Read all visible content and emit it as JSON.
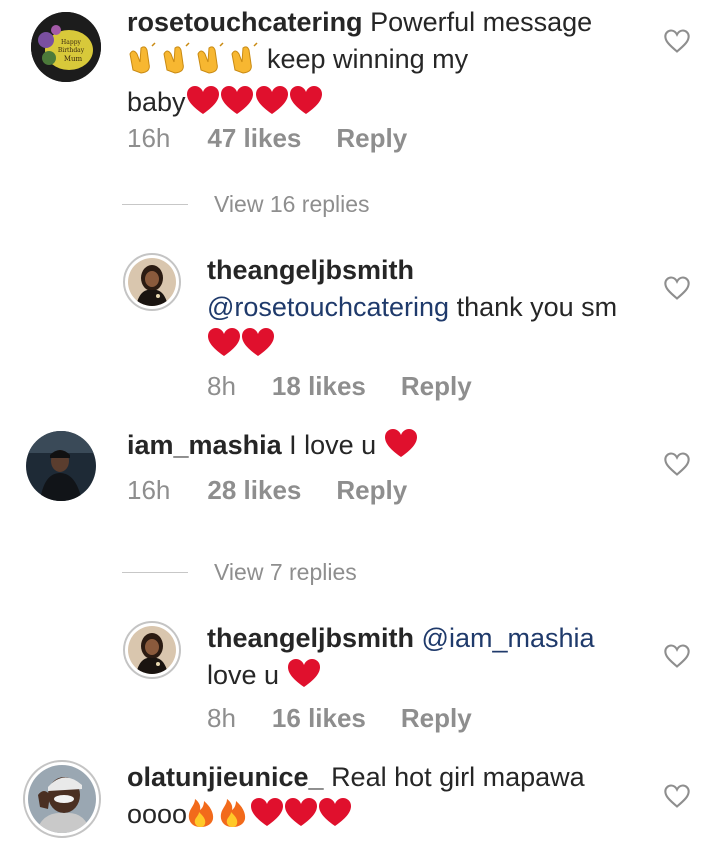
{
  "comments": [
    {
      "username": "rosetouchcatering",
      "text_line1": "Powerful message",
      "text_line2": "keep winning my",
      "text_line3": "baby",
      "time": "16h",
      "likes": "47 likes",
      "reply": "Reply",
      "avatar_text": "Happy Birthday Mum",
      "view_replies": "View 16 replies"
    },
    {
      "username": "theangeljbsmith",
      "mention": "@rosetouchcatering",
      "text": "thank you sm",
      "time": "8h",
      "likes": "18 likes",
      "reply": "Reply"
    },
    {
      "username": "iam_mashia",
      "text": "I love u",
      "time": "16h",
      "likes": "28 likes",
      "reply": "Reply",
      "view_replies": "View 7 replies"
    },
    {
      "username": "theangeljbsmith",
      "mention": "@iam_mashia",
      "text": "love u",
      "time": "8h",
      "likes": "16 likes",
      "reply": "Reply"
    },
    {
      "username": "olatunjieunice_",
      "text_line1": "Real hot girl mapawa",
      "text_line2": "oooo"
    }
  ],
  "icons": {
    "like": "heart-outline-icon",
    "heart_emoji": "red-heart-emoji",
    "clap_emoji": "clapping-hands-emoji",
    "fire_emoji": "fire-emoji"
  },
  "colors": {
    "text": "#262626",
    "meta": "#8e8e8e",
    "mention": "#1f3a6b",
    "heart": "#e0102d",
    "story_ring": "#c4c4c4"
  }
}
